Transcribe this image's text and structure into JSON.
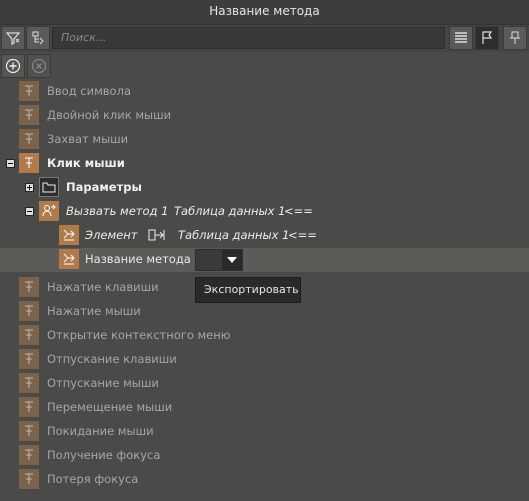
{
  "window": {
    "title": "Название метода"
  },
  "toolbar": {
    "search_placeholder": "Поиск...",
    "filter_icon": "filter-icon",
    "tree_icon": "tree-icon",
    "list_icon": "list-icon",
    "flag_icon": "flag-icon",
    "pin_icon": "pin-icon",
    "add_icon": "plus-circle-icon",
    "remove_icon": "cross-circle-icon"
  },
  "tree": {
    "items": [
      {
        "label": "Ввод символа"
      },
      {
        "label": "Двойной клик мыши"
      },
      {
        "label": "Захват мыши"
      },
      {
        "label": "Клик мыши"
      },
      {
        "label": "Параметры"
      },
      {
        "label": "Вызвать метод 1",
        "target": "Таблица данных 1",
        "arrow": "<=="
      },
      {
        "label": "Элемент",
        "target": "Таблица данных 1",
        "arrow": "<=="
      },
      {
        "label": "Название метода"
      },
      {
        "label": "Нажатие клавиши"
      },
      {
        "label": "Нажатие мыши"
      },
      {
        "label": "Открытие контекстного меню"
      },
      {
        "label": "Отпускание клавиши"
      },
      {
        "label": "Отпускание мыши"
      },
      {
        "label": "Перемещение мыши"
      },
      {
        "label": "Покидание мыши"
      },
      {
        "label": "Получение фокуса"
      },
      {
        "label": "Потеря фокуса"
      }
    ]
  },
  "tooltip": {
    "text": "Экспортировать"
  },
  "colors": {
    "accent": "#b07a4a",
    "background": "#4a4a48"
  }
}
